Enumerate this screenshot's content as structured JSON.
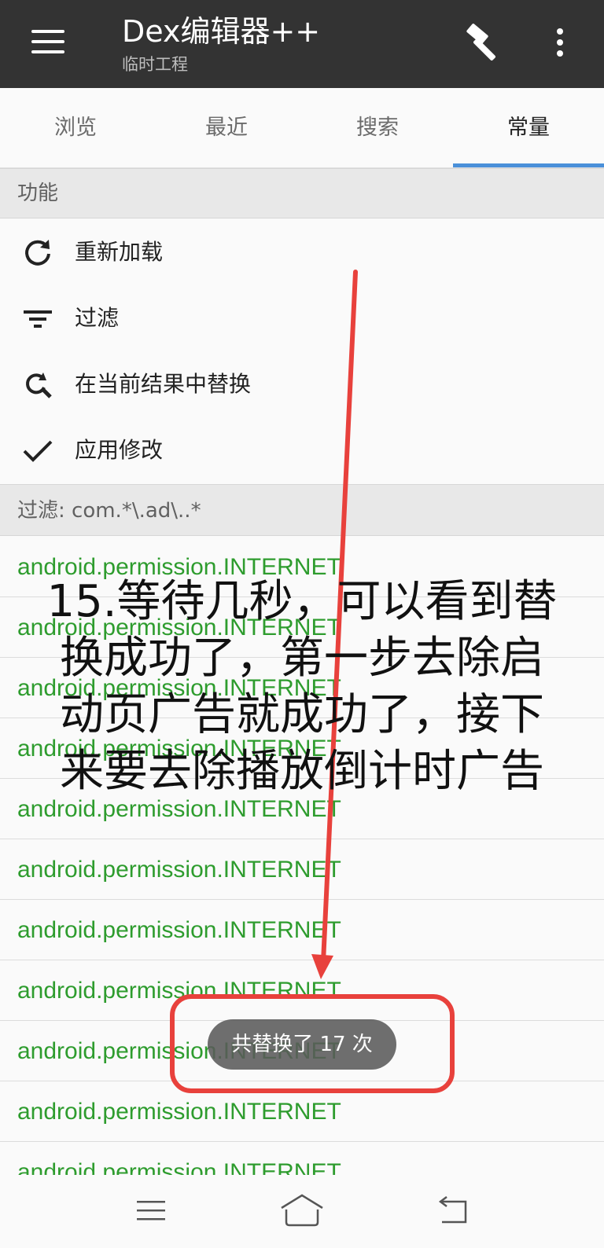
{
  "app_bar": {
    "title": "Dex编辑器++",
    "subtitle": "临时工程",
    "icons": [
      "menu-icon",
      "hammer-icon",
      "more-vert-icon"
    ]
  },
  "tabs": [
    {
      "label": "浏览",
      "active": false
    },
    {
      "label": "最近",
      "active": false
    },
    {
      "label": "搜索",
      "active": false
    },
    {
      "label": "常量",
      "active": true
    }
  ],
  "functions": {
    "header": "功能",
    "items": [
      {
        "label": "重新加载",
        "icon": "reload-icon"
      },
      {
        "label": "过滤",
        "icon": "filter-icon"
      },
      {
        "label": "在当前结果中替换",
        "icon": "find-replace-icon"
      },
      {
        "label": "应用修改",
        "icon": "check-icon"
      }
    ]
  },
  "filter": {
    "header": "过滤: com.*\\.ad\\..*"
  },
  "results": [
    "android.permission.INTERNET",
    "android.permission.INTERNET",
    "android.permission.INTERNET",
    "android.permission.INTERNET",
    "android.permission.INTERNET",
    "android.permission.INTERNET",
    "android.permission.INTERNET",
    "android.permission.INTERNET",
    "android.permission.INTERNET",
    "android.permission.INTERNET",
    "android.permission.INTERNET"
  ],
  "toast": "共替换了 17 次",
  "annotation": {
    "line1": "15.等待几秒，可以看到替",
    "line2": "换成功了，第一步去除启",
    "line3": "动页广告就成功了，接下",
    "line4": "来要去除播放倒计时广告",
    "color": "#e8413c"
  },
  "colors": {
    "app_bar": "#333333",
    "tab_indicator": "#4a90d9",
    "result_text": "#2e9c2e"
  },
  "nav_bar": {
    "icons": [
      "recents-icon",
      "home-icon",
      "back-icon"
    ]
  }
}
